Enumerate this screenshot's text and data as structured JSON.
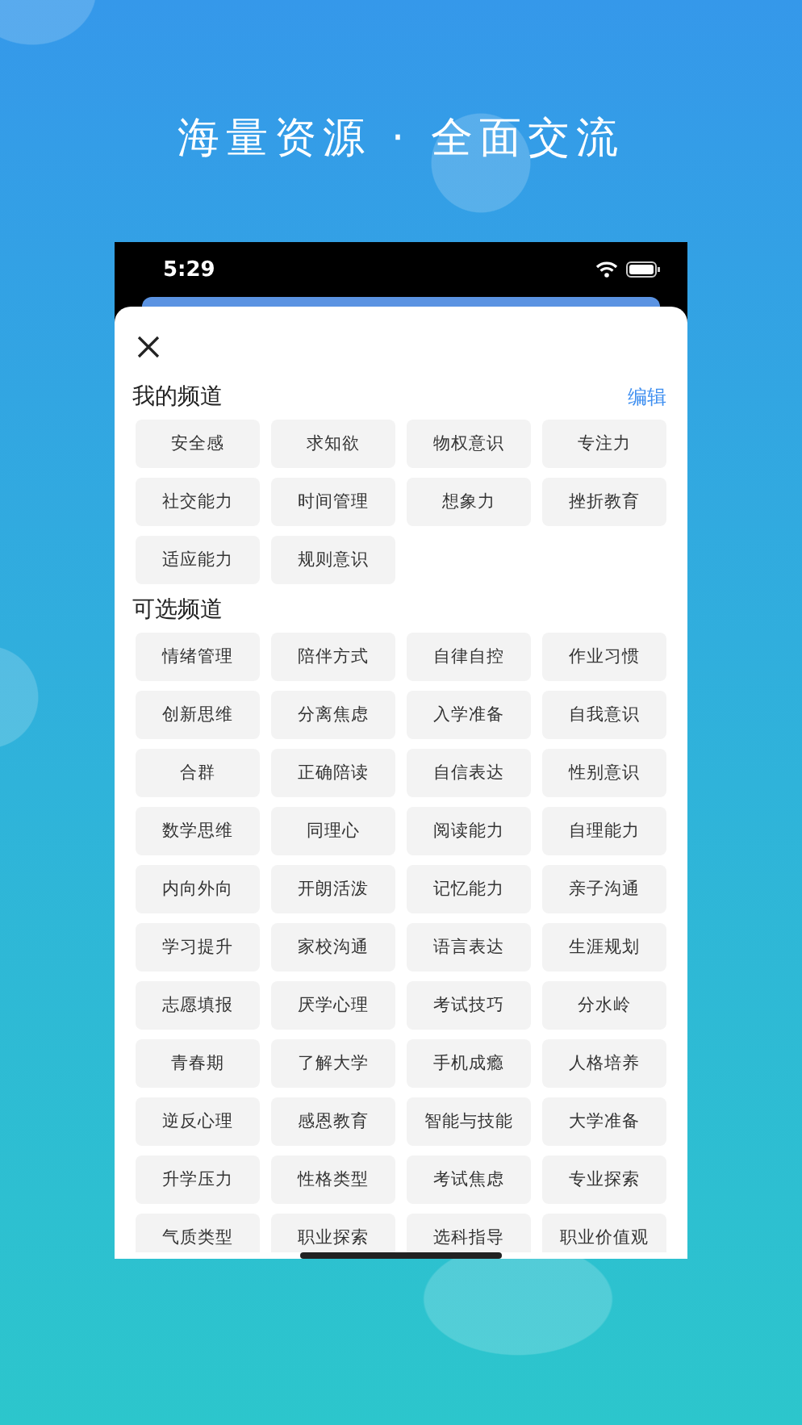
{
  "headline": "海量资源 · 全面交流",
  "status_bar": {
    "time": "5:29"
  },
  "sections": [
    {
      "title": "我的频道",
      "action": "编辑",
      "channels": [
        "安全感",
        "求知欲",
        "物权意识",
        "专注力",
        "社交能力",
        "时间管理",
        "想象力",
        "挫折教育",
        "适应能力",
        "规则意识"
      ]
    },
    {
      "title": "可选频道",
      "channels": [
        "情绪管理",
        "陪伴方式",
        "自律自控",
        "作业习惯",
        "创新思维",
        "分离焦虑",
        "入学准备",
        "自我意识",
        "合群",
        "正确陪读",
        "自信表达",
        "性别意识",
        "数学思维",
        "同理心",
        "阅读能力",
        "自理能力",
        "内向外向",
        "开朗活泼",
        "记忆能力",
        "亲子沟通",
        "学习提升",
        "家校沟通",
        "语言表达",
        "生涯规划",
        "志愿填报",
        "厌学心理",
        "考试技巧",
        "分水岭",
        "青春期",
        "了解大学",
        "手机成瘾",
        "人格培养",
        "逆反心理",
        "感恩教育",
        "智能与技能",
        "大学准备",
        "升学压力",
        "性格类型",
        "考试焦虑",
        "专业探索",
        "气质类型",
        "职业探索",
        "选科指导",
        "职业价值观"
      ]
    }
  ]
}
